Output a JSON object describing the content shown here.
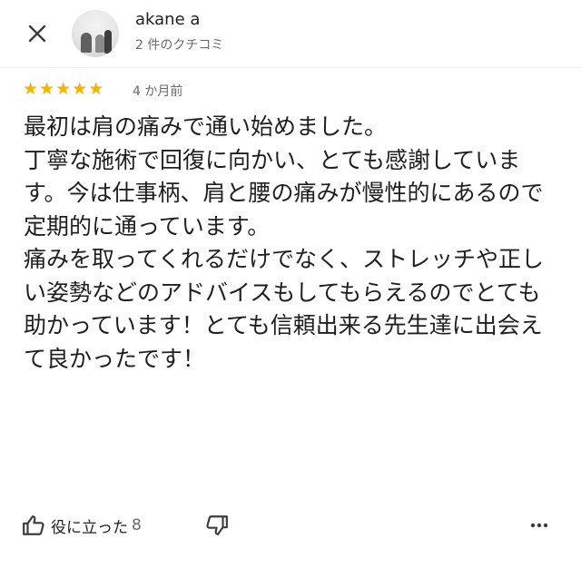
{
  "header": {
    "name": "akane a",
    "review_count": "2 件のクチコミ"
  },
  "review": {
    "rating": 5,
    "date": "4 か月前",
    "paragraphs": [
      "最初は肩の痛みで通い始めました。",
      "丁寧な施術で回復に向かい、とても感謝しています。今は仕事柄、肩と腰の痛みが慢性的にあるので定期的に通っています。",
      "痛みを取ってくれるだけでなく、ストレッチや正しい姿勢などのアドバイスもしてもらえるのでとても助かっています！とても信頼出来る先生達に出会えて良かったです！"
    ]
  },
  "actions": {
    "helpful_label": "役に立った",
    "helpful_count": "8"
  },
  "icons": {
    "close": "close-icon",
    "avatar": "profile-photo",
    "star": "star-icon",
    "thumb_up": "thumb-up-icon",
    "thumb_down": "thumb-down-icon",
    "more": "more-vert-icon"
  },
  "colors": {
    "star": "#f5b400",
    "text": "#202124",
    "secondary_text": "#6b6b6b"
  }
}
